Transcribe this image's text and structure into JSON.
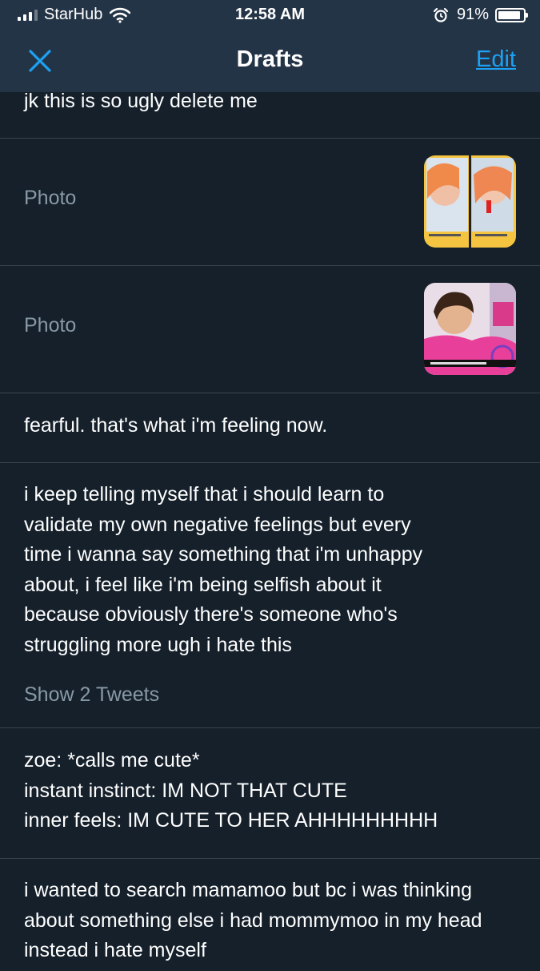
{
  "status_bar": {
    "carrier": "StarHub",
    "time": "12:58 AM",
    "battery_percent_label": "91%",
    "battery_level": 0.91
  },
  "nav": {
    "title": "Drafts",
    "edit_label": "Edit",
    "accent_color": "#1da1f2"
  },
  "drafts": [
    {
      "text": "jk this is so ugly delete me"
    },
    {
      "label": "Photo"
    },
    {
      "label": "Photo"
    },
    {
      "text": "fearful. that's what i'm feeling now."
    },
    {
      "text": "i keep telling myself that i should learn to validate my own negative feelings but every time i wanna say something that i'm unhappy about, i feel like i'm being selfish about it because obviously there's someone who's struggling more ugh i hate this",
      "show_more": "Show 2 Tweets"
    },
    {
      "text": "zoe: *calls me cute*\ninstant instinct: IM NOT THAT CUTE\ninner feels: IM CUTE TO HER AHHHHHHHHH"
    },
    {
      "text": "i wanted to search mamamoo but bc i was thinking about something else i had mommymoo in my head instead i hate myself"
    }
  ]
}
